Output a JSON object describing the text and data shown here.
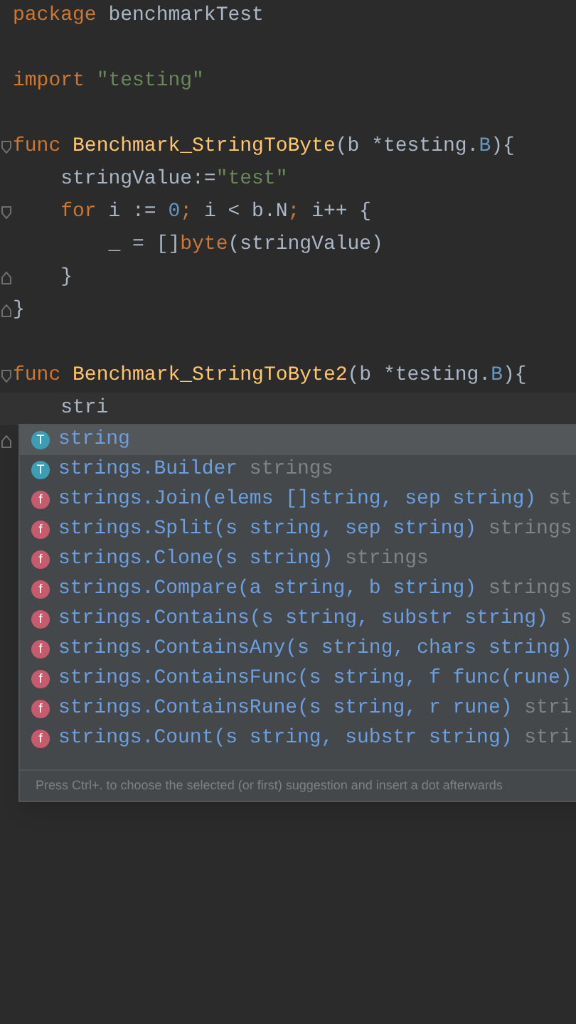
{
  "code_lines": [
    {
      "tokens": [
        {
          "t": "package ",
          "kind": "kw"
        },
        {
          "t": "benchmarkTest",
          "kind": "plain"
        }
      ]
    },
    {
      "blank_before": true,
      "tokens": [
        {
          "t": "import ",
          "kind": "kw"
        },
        {
          "t": "\"testing\"",
          "kind": "str"
        }
      ]
    },
    {
      "blank_before": true,
      "fold_start": true,
      "tokens": [
        {
          "t": "func ",
          "kind": "kw"
        },
        {
          "t": "Benchmark_StringToByte",
          "kind": "fn"
        },
        {
          "t": "(b *testing.",
          "kind": "plain"
        },
        {
          "t": "B",
          "kind": "const"
        },
        {
          "t": "){",
          "kind": "plain"
        }
      ]
    },
    {
      "tokens": [
        {
          "t": "    stringValue:=",
          "kind": "plain"
        },
        {
          "t": "\"test\"",
          "kind": "str"
        }
      ]
    },
    {
      "fold_start": true,
      "tokens": [
        {
          "t": "    for ",
          "kind": "kw"
        },
        {
          "t": "i := ",
          "kind": "plain"
        },
        {
          "t": "0",
          "kind": "const"
        },
        {
          "t": "; ",
          "kind": "kw"
        },
        {
          "t": "i < b.N",
          "kind": "plain"
        },
        {
          "t": "; ",
          "kind": "kw"
        },
        {
          "t": "i++ {",
          "kind": "plain"
        }
      ]
    },
    {
      "tokens": [
        {
          "t": "        _ = []",
          "kind": "plain"
        },
        {
          "t": "byte",
          "kind": "kw"
        },
        {
          "t": "(stringValue)",
          "kind": "plain"
        }
      ]
    },
    {
      "fold_end": true,
      "tokens": [
        {
          "t": "    }",
          "kind": "plain"
        }
      ]
    },
    {
      "fold_end": true,
      "tokens": [
        {
          "t": "}",
          "kind": "plain"
        }
      ]
    },
    {
      "blank_before": true,
      "fold_start": true,
      "tokens": [
        {
          "t": "func ",
          "kind": "kw"
        },
        {
          "t": "Benchmark_StringToByte2",
          "kind": "fn"
        },
        {
          "t": "(b *testing.",
          "kind": "plain"
        },
        {
          "t": "B",
          "kind": "const"
        },
        {
          "t": "){",
          "kind": "plain"
        }
      ]
    },
    {
      "current": true,
      "tokens": [
        {
          "t": "    stri",
          "kind": "plain"
        }
      ]
    },
    {
      "fold_end": true
    }
  ],
  "completion": {
    "items": [
      {
        "kind": "type",
        "icon_letter": "T",
        "label": "string",
        "selected": true
      },
      {
        "kind": "type",
        "icon_letter": "T",
        "label": "strings.Builder",
        "detail": "strings",
        "selected": false
      },
      {
        "kind": "func",
        "icon_letter": "f",
        "label": "strings.Join(elems []string, sep string)",
        "detail": "st",
        "selected": false
      },
      {
        "kind": "func",
        "icon_letter": "f",
        "label": "strings.Split(s string, sep string)",
        "detail": "strings",
        "selected": false
      },
      {
        "kind": "func",
        "icon_letter": "f",
        "label": "strings.Clone(s string)",
        "detail": "strings",
        "selected": false
      },
      {
        "kind": "func",
        "icon_letter": "f",
        "label": "strings.Compare(a string, b string)",
        "detail": "strings",
        "selected": false
      },
      {
        "kind": "func",
        "icon_letter": "f",
        "label": "strings.Contains(s string, substr string)",
        "detail": "s",
        "selected": false
      },
      {
        "kind": "func",
        "icon_letter": "f",
        "label": "strings.ContainsAny(s string, chars string)",
        "selected": false
      },
      {
        "kind": "func",
        "icon_letter": "f",
        "label": "strings.ContainsFunc(s string, f func(rune)",
        "selected": false
      },
      {
        "kind": "func",
        "icon_letter": "f",
        "label": "strings.ContainsRune(s string, r rune)",
        "detail": "stri",
        "selected": false
      },
      {
        "kind": "func",
        "icon_letter": "f",
        "label": "strings.Count(s string, substr string)",
        "detail": "stri",
        "selected": false
      }
    ],
    "hint": "Press Ctrl+. to choose the selected (or first) suggestion and insert a dot afterwards"
  }
}
